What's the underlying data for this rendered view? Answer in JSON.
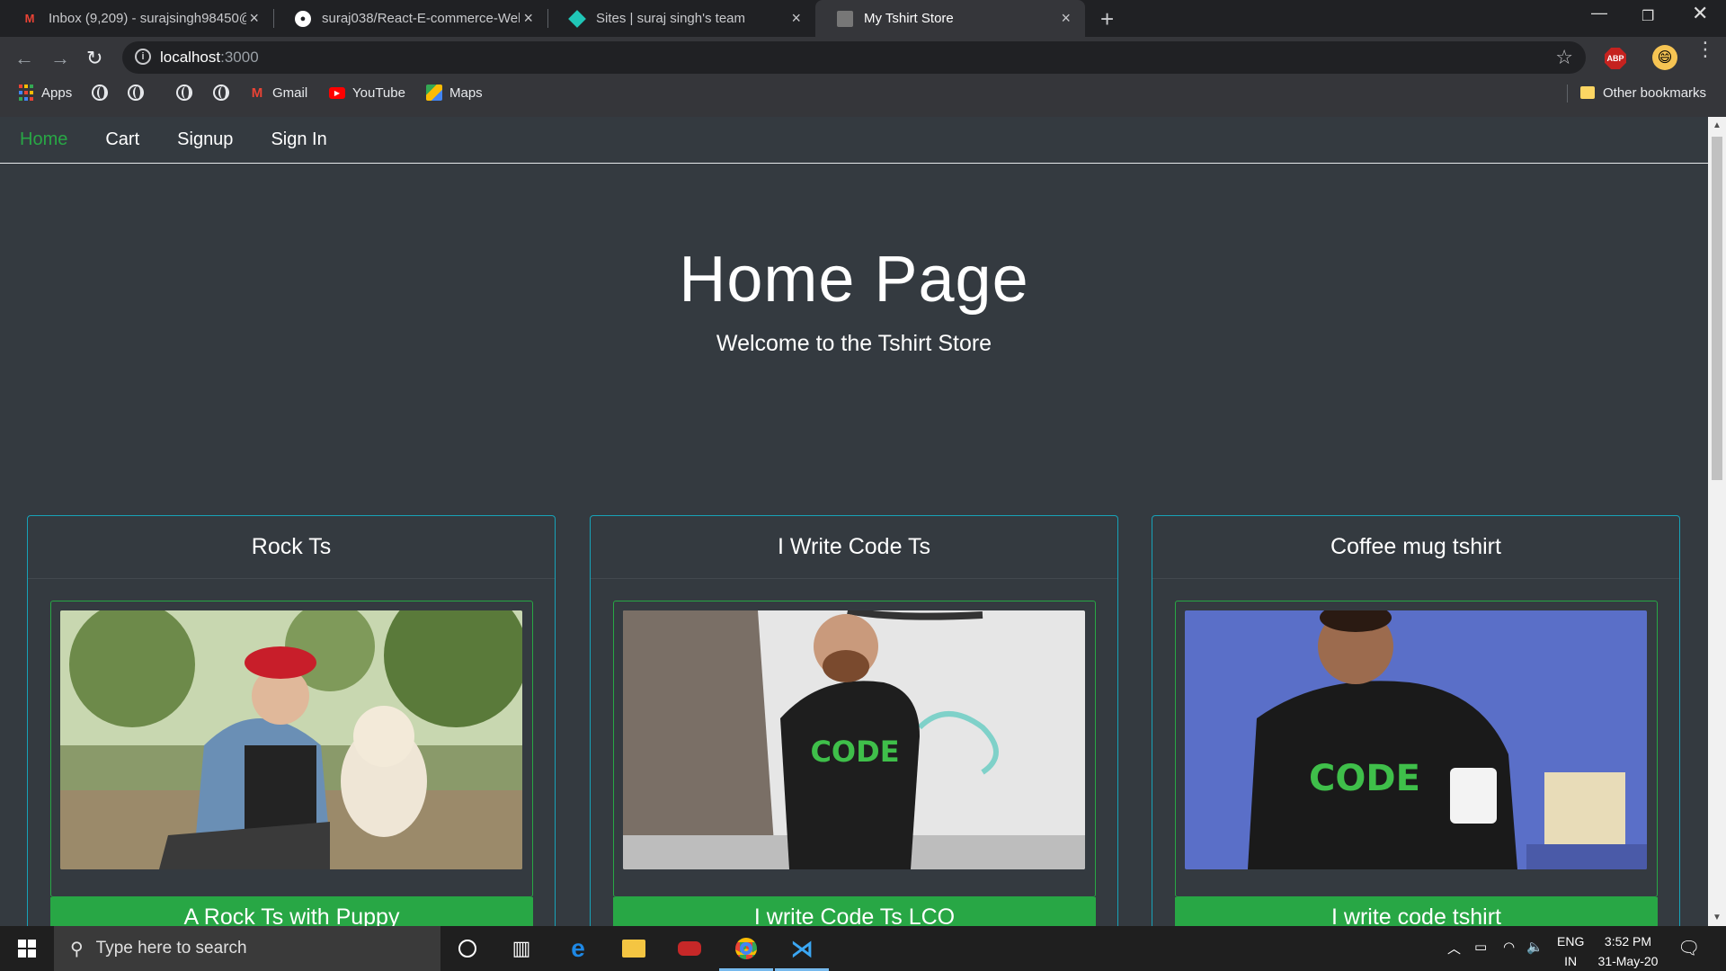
{
  "browser": {
    "tabs": [
      {
        "title": "Inbox (9,209) - surajsingh98450@",
        "icon": "gmail-icon"
      },
      {
        "title": "suraj038/React-E-commerce-Web",
        "icon": "github-icon"
      },
      {
        "title": "Sites | suraj singh's team",
        "icon": "netlify-icon"
      },
      {
        "title": "My Tshirt Store",
        "icon": "site-icon"
      }
    ],
    "url_host": "localhost",
    "url_port": ":3000",
    "bookmarks": [
      {
        "label": "Apps"
      },
      {
        "label": ""
      },
      {
        "label": ""
      },
      {
        "label": ""
      },
      {
        "label": ""
      },
      {
        "label": "Gmail"
      },
      {
        "label": "YouTube"
      },
      {
        "label": "Maps"
      }
    ],
    "other_bookmarks": "Other bookmarks",
    "abp": "ABP"
  },
  "nav": {
    "items": [
      "Home",
      "Cart",
      "Signup",
      "Sign In"
    ]
  },
  "hero": {
    "title": "Home Page",
    "subtitle": "Welcome to the Tshirt Store"
  },
  "products": [
    {
      "title": "Rock Ts",
      "button": "A Rock Ts with Puppy"
    },
    {
      "title": "I Write Code Ts",
      "button": "I write Code Ts LCO"
    },
    {
      "title": "Coffee mug tshirt",
      "button": "I write code tshirt"
    }
  ],
  "taskbar": {
    "search_placeholder": "Type here to search",
    "lang1": "ENG",
    "lang2": "IN",
    "time": "3:52 PM",
    "date": "31-May-20"
  },
  "colors": {
    "accent": "#28a745",
    "page_bg": "#343a40",
    "card_border": "#17a2b8"
  }
}
